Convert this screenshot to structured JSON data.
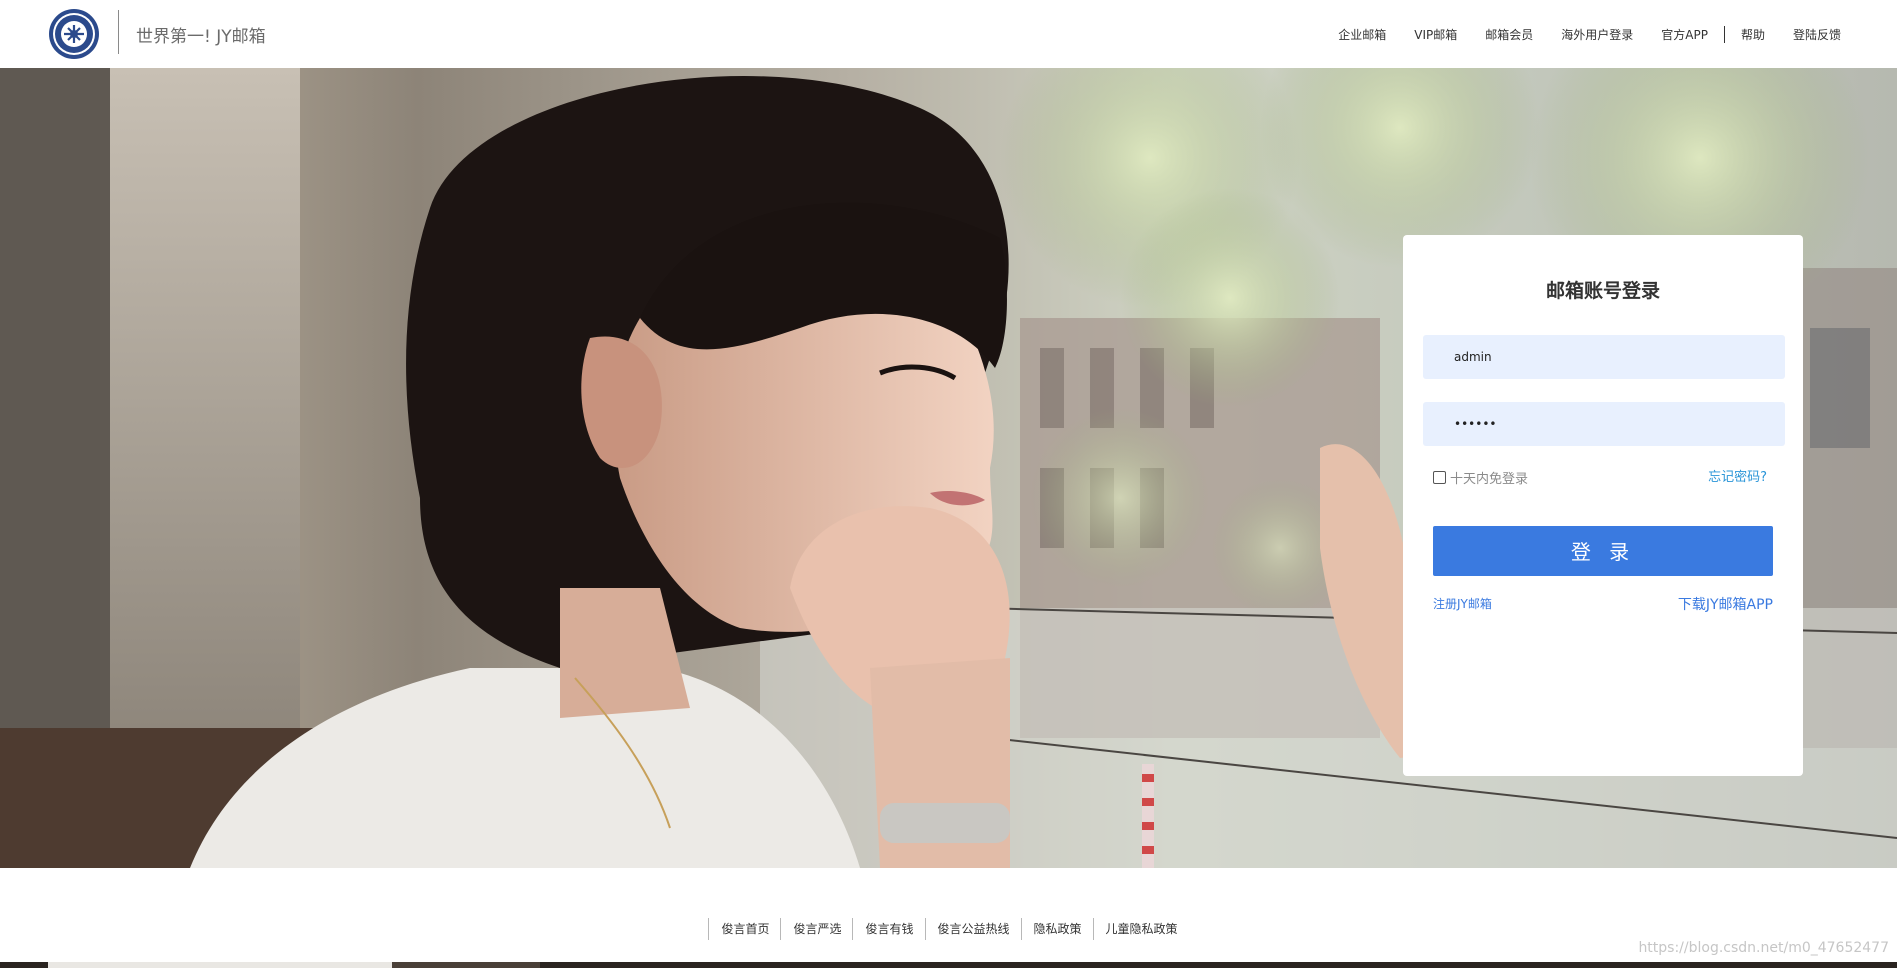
{
  "header": {
    "site_title": "世界第一! JY邮箱",
    "logo_icon": "university-seal-logo",
    "nav_items": [
      "企业邮箱",
      "VIP邮箱",
      "邮箱会员",
      "海外用户登录",
      "官方APP",
      "帮助",
      "登陆反馈"
    ]
  },
  "login": {
    "title": "邮箱账号登录",
    "username_value": "admin",
    "password_value": "••••••",
    "remember_label": "十天内免登录",
    "remember_checked": false,
    "forgot_label": "忘记密码?",
    "submit_label": "登 录",
    "register_label": "注册JY邮箱",
    "download_label": "下载JY邮箱APP"
  },
  "footer": {
    "links": [
      "俊言首页",
      "俊言严选",
      "俊言有钱",
      "俊言公益热线",
      "隐私政策",
      "儿童隐私政策"
    ],
    "watermark": "https://blog.csdn.net/m0_47652477"
  },
  "colors": {
    "primary": "#3a7ae0",
    "link": "#2a95d8",
    "input_bg": "#e8f0fe"
  }
}
